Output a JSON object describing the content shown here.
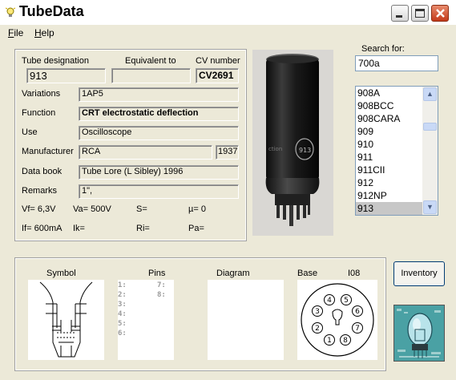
{
  "window": {
    "title": "TubeData"
  },
  "menu": [
    {
      "label": "File"
    },
    {
      "label": "Help"
    }
  ],
  "details": {
    "tube_designation_label": "Tube designation",
    "equivalent_to_label": "Equivalent to",
    "cv_number_label": "CV number",
    "tube_designation": "913",
    "equivalent_to": "",
    "cv_number": "CV2691",
    "variations_label": "Variations",
    "variations": "1AP5",
    "function_label": "Function",
    "function": "CRT electrostatic deflection",
    "use_label": "Use",
    "use": "Oscilloscope",
    "manufacturer_label": "Manufacturer",
    "manufacturer": "RCA",
    "year": "1937",
    "data_book_label": "Data book",
    "data_book": "Tube Lore (L Sibley) 1996",
    "remarks_label": "Remarks",
    "remarks": "1\",",
    "params_row1": [
      "Vf= 6,3V",
      "Va= 500V",
      "S=",
      "µ=   0"
    ],
    "params_row2": [
      "If= 600mA",
      "Ik=",
      "Ri=",
      "Pa="
    ]
  },
  "search": {
    "label": "Search for:",
    "value": "700a"
  },
  "tube_list": {
    "items": [
      "908A",
      "908BCC",
      "908CARA",
      "909",
      "910",
      "911",
      "911CII",
      "912",
      "912NP",
      "913"
    ],
    "selected": "913"
  },
  "bottom": {
    "symbol_label": "Symbol",
    "pins_label": "Pins",
    "diagram_label": "Diagram",
    "base_label": "Base",
    "base_type": "I08",
    "pins": [
      "1:",
      "2:",
      "3:",
      "4:",
      "5:",
      "6:",
      "7:",
      "8:"
    ],
    "base_pin_numbers": [
      "1",
      "2",
      "3",
      "4",
      "5",
      "6",
      "7",
      "8"
    ]
  },
  "inventory_button": "Inventory",
  "icons": {
    "title": "bulb-icon",
    "minimize": "minimize-icon",
    "maximize": "maximize-icon",
    "close": "close-icon"
  }
}
